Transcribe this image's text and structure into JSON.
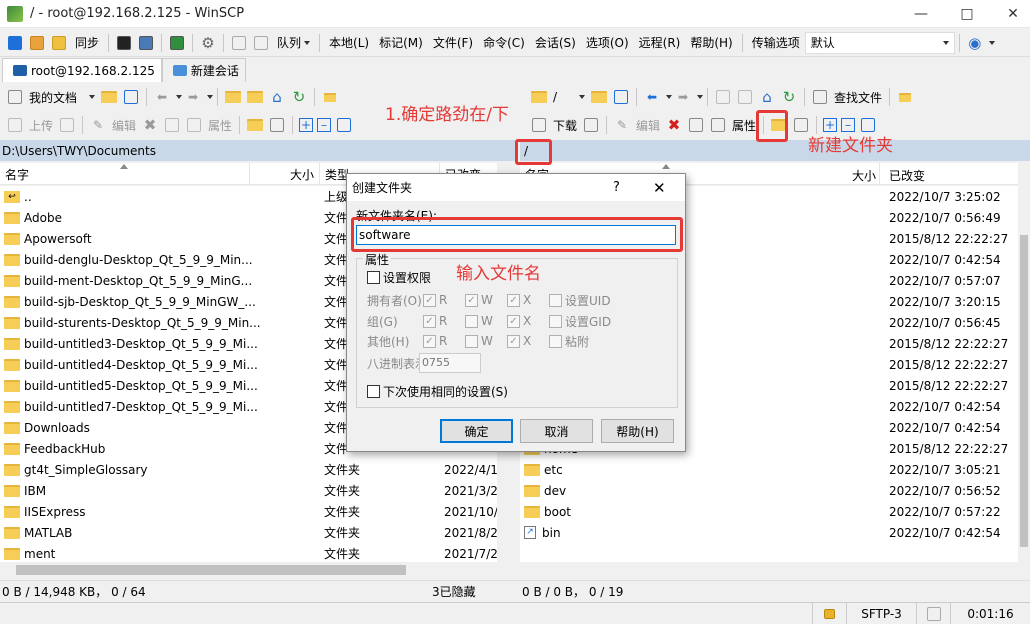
{
  "window": {
    "title": "/ - root@192.168.2.125 - WinSCP"
  },
  "menubar": {
    "sync_label": "同步",
    "queue_label": "队列",
    "items": [
      "本地(L)",
      "标记(M)",
      "文件(F)",
      "命令(C)",
      "会话(S)",
      "选项(O)",
      "远程(R)",
      "帮助(H)"
    ],
    "transfer_label": "传输选项",
    "transfer_value": "默认"
  },
  "tabs": {
    "session": "root@192.168.2.125",
    "new_session": "新建会话"
  },
  "left": {
    "location": "我的文档",
    "upload_label": "上传",
    "edit_label": "编辑",
    "props_label": "属性",
    "path": "D:\\Users\\TWY\\Documents",
    "headers": {
      "name": "名字",
      "size": "大小",
      "type": "类型",
      "changed": "已改变"
    },
    "rows": [
      {
        "name": "..",
        "type": "上级",
        "changed": ""
      },
      {
        "name": "Adobe",
        "type": "文件",
        "changed": ""
      },
      {
        "name": "Apowersoft",
        "type": "文件",
        "changed": ""
      },
      {
        "name": "build-denglu-Desktop_Qt_5_9_9_Min...",
        "type": "文件",
        "changed": ""
      },
      {
        "name": "build-ment-Desktop_Qt_5_9_9_MinG...",
        "type": "文件",
        "changed": ""
      },
      {
        "name": "build-sjb-Desktop_Qt_5_9_9_MinGW_...",
        "type": "文件",
        "changed": ""
      },
      {
        "name": "build-sturents-Desktop_Qt_5_9_9_Min...",
        "type": "文件",
        "changed": ""
      },
      {
        "name": "build-untitled3-Desktop_Qt_5_9_9_Mi...",
        "type": "文件",
        "changed": ""
      },
      {
        "name": "build-untitled4-Desktop_Qt_5_9_9_Mi...",
        "type": "文件",
        "changed": ""
      },
      {
        "name": "build-untitled5-Desktop_Qt_5_9_9_Mi...",
        "type": "文件",
        "changed": ""
      },
      {
        "name": "build-untitled7-Desktop_Qt_5_9_9_Mi...",
        "type": "文件",
        "changed": ""
      },
      {
        "name": "Downloads",
        "type": "文件",
        "changed": ""
      },
      {
        "name": "FeedbackHub",
        "type": "文件",
        "changed": ""
      },
      {
        "name": "gt4t_SimpleGlossary",
        "type": "文件夹",
        "changed": "2022/4/1"
      },
      {
        "name": "IBM",
        "type": "文件夹",
        "changed": "2021/3/2"
      },
      {
        "name": "IISExpress",
        "type": "文件夹",
        "changed": "2021/10/"
      },
      {
        "name": "MATLAB",
        "type": "文件夹",
        "changed": "2021/8/2"
      },
      {
        "name": "ment",
        "type": "文件夹",
        "changed": "2021/7/2"
      }
    ],
    "status": "0 B / 14,948 KB， 0 / 64",
    "hidden": "3已隐藏"
  },
  "right": {
    "location": "/",
    "download_label": "下载",
    "edit_label": "编辑",
    "props_label": "属性",
    "find_label": "查找文件",
    "path": "/",
    "headers": {
      "name": "名字",
      "size": "大小",
      "changed": "已改变"
    },
    "rows": [
      {
        "name": "",
        "changed": "2022/10/7 3:25:02",
        "icon": "up"
      },
      {
        "name": "",
        "changed": "2022/10/7 0:56:49",
        "icon": "folder"
      },
      {
        "name": "",
        "changed": "2015/8/12 22:22:27",
        "icon": "folder"
      },
      {
        "name": "",
        "changed": "2022/10/7 0:42:54",
        "icon": "folder"
      },
      {
        "name": "",
        "changed": "2022/10/7 0:57:07",
        "icon": "folder"
      },
      {
        "name": "",
        "changed": "2022/10/7 3:20:15",
        "icon": "folder"
      },
      {
        "name": "",
        "changed": "2022/10/7 0:56:45",
        "icon": "folder"
      },
      {
        "name": "",
        "changed": "2015/8/12 22:22:27",
        "icon": "folder"
      },
      {
        "name": "",
        "changed": "2015/8/12 22:22:27",
        "icon": "folder"
      },
      {
        "name": "",
        "changed": "2015/8/12 22:22:27",
        "icon": "folder"
      },
      {
        "name": "",
        "changed": "2022/10/7 0:42:54",
        "icon": "folder"
      },
      {
        "name": "",
        "changed": "2022/10/7 0:42:54",
        "icon": "folder"
      },
      {
        "name": "home",
        "changed": "2015/8/12 22:22:27",
        "icon": "folder"
      },
      {
        "name": "etc",
        "changed": "2022/10/7 3:05:21",
        "icon": "folder"
      },
      {
        "name": "dev",
        "changed": "2022/10/7 0:56:52",
        "icon": "folder"
      },
      {
        "name": "boot",
        "changed": "2022/10/7 0:57:22",
        "icon": "folder"
      },
      {
        "name": "bin",
        "changed": "2022/10/7 0:42:54",
        "icon": "link"
      }
    ],
    "status": "0 B / 0 B， 0 / 19"
  },
  "bottom": {
    "protocol": "SFTP-3",
    "time": "0:01:16"
  },
  "dialog": {
    "title": "创建文件夹",
    "help_glyph": "?",
    "name_label": "新文件夹名(E):",
    "name_value": "software",
    "attrs_label": "属性",
    "set_perm_label": "设置权限",
    "owner_label": "拥有者(O)",
    "group_label": "组(G)",
    "other_label": "其他(H)",
    "r": "R",
    "w": "W",
    "x": "X",
    "uid_label": "设置UID",
    "gid_label": "设置GID",
    "sticky_label": "粘附",
    "octal_label": "八进制表示",
    "octal_value": "0755",
    "reuse_label": "下次使用相同的设置(S)",
    "ok": "确定",
    "cancel": "取消",
    "help": "帮助(H)"
  },
  "annotations": {
    "path_note": "1.确定路劲在/下",
    "new_folder_note": "新建文件夹",
    "input_note": "输入文件名"
  },
  "colors": {
    "accent": "#e53935",
    "pathbar": "#c9d8e8",
    "folder": "#f6cd57"
  }
}
